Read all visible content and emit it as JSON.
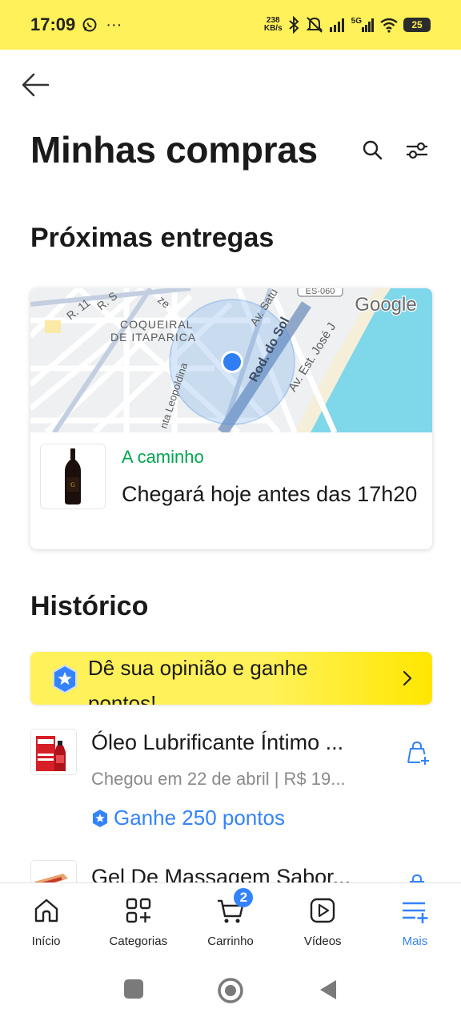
{
  "status_bar": {
    "time": "17:09",
    "dots": "···",
    "net_speed_value": "238",
    "net_speed_unit": "KB/s",
    "network": "5G",
    "battery": "25"
  },
  "header": {
    "title": "Minhas compras"
  },
  "upcoming": {
    "section_title": "Próximas entregas",
    "map": {
      "labels": {
        "neighborhood_1": "COQUEIRAL",
        "neighborhood_2": "DE ITAPARICA",
        "street_r11": "R. 11",
        "street_rs": "R. S",
        "street_ze": "ze",
        "street_satu": "Av. Satu",
        "street_rod": "Rod. do Sol",
        "street_leopoldina": "nta Leopoldina",
        "street_est": "Av. Est. José J",
        "road_badge": "ES-060",
        "google": "Google"
      }
    },
    "delivery": {
      "status": "A caminho",
      "message": "Chegará hoje antes das 17h20"
    }
  },
  "history": {
    "section_title": "Histórico",
    "opinion_banner": {
      "text": "Dê sua opinião e ganhe pontos!"
    },
    "items": [
      {
        "title": "Óleo Lubrificante Íntimo ...",
        "subtitle": "Chegou em 22 de abril | R$ 19...",
        "points": "Ganhe 250 pontos"
      },
      {
        "title": "Gel De Massagem Sabor..."
      }
    ]
  },
  "bottom_nav": {
    "items": [
      {
        "label": "Início",
        "icon": "home-icon"
      },
      {
        "label": "Categorias",
        "icon": "categories-icon"
      },
      {
        "label": "Carrinho",
        "icon": "cart-icon",
        "badge": "2"
      },
      {
        "label": "Vídeos",
        "icon": "video-icon"
      },
      {
        "label": "Mais",
        "icon": "more-menu-icon",
        "active": true
      }
    ]
  },
  "colors": {
    "brand_yellow": "#fff159",
    "accent_blue": "#3483fa",
    "success_green": "#00a650"
  }
}
